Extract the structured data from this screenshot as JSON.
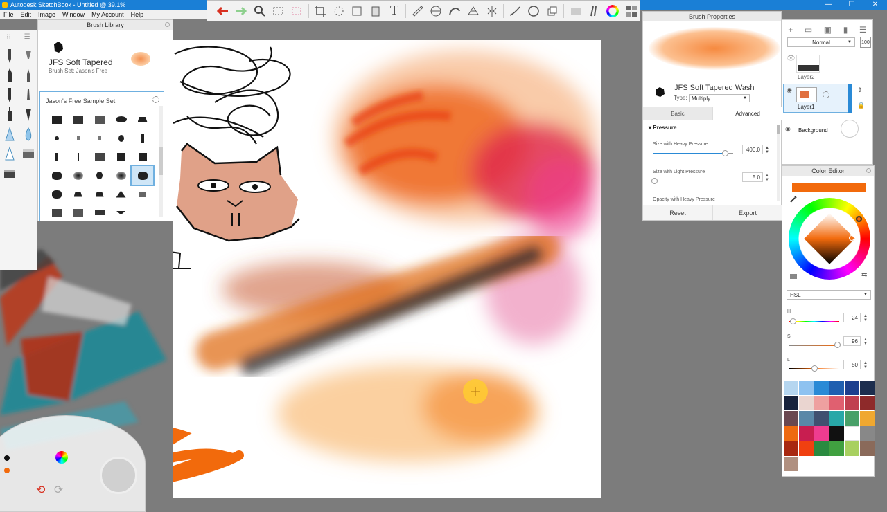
{
  "app": {
    "title": "Autodesk SketchBook - Untitled @ 39.1%"
  },
  "window_controls": {
    "minimize": "—",
    "maximize": "☐",
    "close": "✕"
  },
  "menu": {
    "items": [
      "File",
      "Edit",
      "Image",
      "Window",
      "My Account",
      "Help"
    ]
  },
  "toolbar": {
    "icons": [
      "undo-icon",
      "redo-icon",
      "zoom-icon",
      "select-icon",
      "magic-select-icon",
      "crop-icon",
      "transform-icon",
      "distort-icon",
      "fill-icon",
      "text-icon",
      "ruler-icon",
      "ellipse-guide-icon",
      "french-curve-icon",
      "perspective-icon",
      "symmetry-icon",
      "stroke-icon",
      "ellipse-icon",
      "layer-icon",
      "copic-icon",
      "color-wheel-icon",
      "palette-icon"
    ],
    "text_tool_glyph": "T"
  },
  "brush_library": {
    "title": "Brush Library",
    "brush_name": "JFS Soft Tapered",
    "brush_set": "Brush Set: Jason's Free",
    "grid_title": "Jason's Free Sample Set"
  },
  "brush_properties": {
    "title": "Brush Properties",
    "brush_name": "JFS Soft Tapered Wash",
    "type_label": "Type:",
    "type_value": "Multiply",
    "tab_basic": "Basic",
    "tab_advanced": "Advanced",
    "section": "Pressure",
    "size_heavy_label": "Size with Heavy Pressure",
    "size_heavy_value": "400.0",
    "size_light_label": "Size with Light Pressure",
    "size_light_value": "5.0",
    "opacity_heavy_label": "Opacity with Heavy Pressure",
    "reset_label": "Reset",
    "export_label": "Export",
    "size_heavy_fraction": 0.9,
    "size_light_fraction": 0.02
  },
  "layers": {
    "blend_mode": "Normal",
    "items": [
      {
        "name": "Layer2",
        "selected": false
      },
      {
        "name": "Layer1",
        "selected": true
      },
      {
        "name": "Background",
        "selected": false
      }
    ]
  },
  "color_editor": {
    "title": "Color Editor",
    "current_color": "#f26a0c",
    "mode": "HSL",
    "h_label": "H",
    "h_value": "24",
    "s_label": "S",
    "s_value": "96",
    "l_label": "L",
    "l_value": "50",
    "h_fraction": 0.07,
    "s_fraction": 0.96,
    "l_fraction": 0.5,
    "swatches": [
      "#b5d6f0",
      "#8ec2f0",
      "#2a8ad6",
      "#1f5fb0",
      "#1c3f8e",
      "#1d2e4e",
      "#17223c",
      "#ead5d0",
      "#eea0a0",
      "#e06070",
      "#c04050",
      "#8e2a2a",
      "#6a4850",
      "#5a88a8",
      "#405070",
      "#28a8a8",
      "#48a068",
      "#f0a830",
      "#ee6a10",
      "#c81e50",
      "#ee3c90",
      "#111111",
      "#ffffff",
      "#888888",
      "#a82810",
      "#f04010",
      "#2a8a40",
      "#40a040",
      "#a8d060",
      "#8a6a5a",
      "#b09080"
    ]
  }
}
